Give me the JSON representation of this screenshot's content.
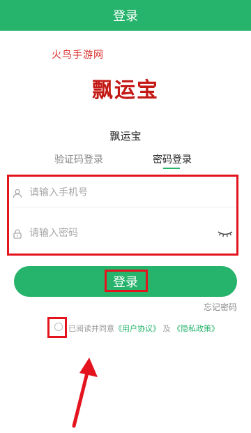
{
  "header": {
    "title": "登录"
  },
  "watermark": "火鸟手游网",
  "logo_text": "飘运宝",
  "app_name": "飘运宝",
  "tabs": [
    {
      "label": "验证码登录",
      "active": false
    },
    {
      "label": "密码登录",
      "active": true
    }
  ],
  "phone_field": {
    "placeholder": "请输入手机号",
    "value": "",
    "icon": "user-icon"
  },
  "password_field": {
    "placeholder": "请输入密码",
    "value": "",
    "icon": "lock-icon",
    "toggle_icon": "eye-closed-icon"
  },
  "login_button": {
    "label": "登录"
  },
  "forgot_link": "忘记密码",
  "agreement": {
    "prefix": "已阅读并同意",
    "user_agreement": "《用户协议》",
    "conjunction": "及",
    "privacy_policy": "《隐私政策》",
    "checked": false
  },
  "colors": {
    "brand": "#26b36b",
    "highlight": "#e3141d",
    "logo": "#c41a16"
  }
}
